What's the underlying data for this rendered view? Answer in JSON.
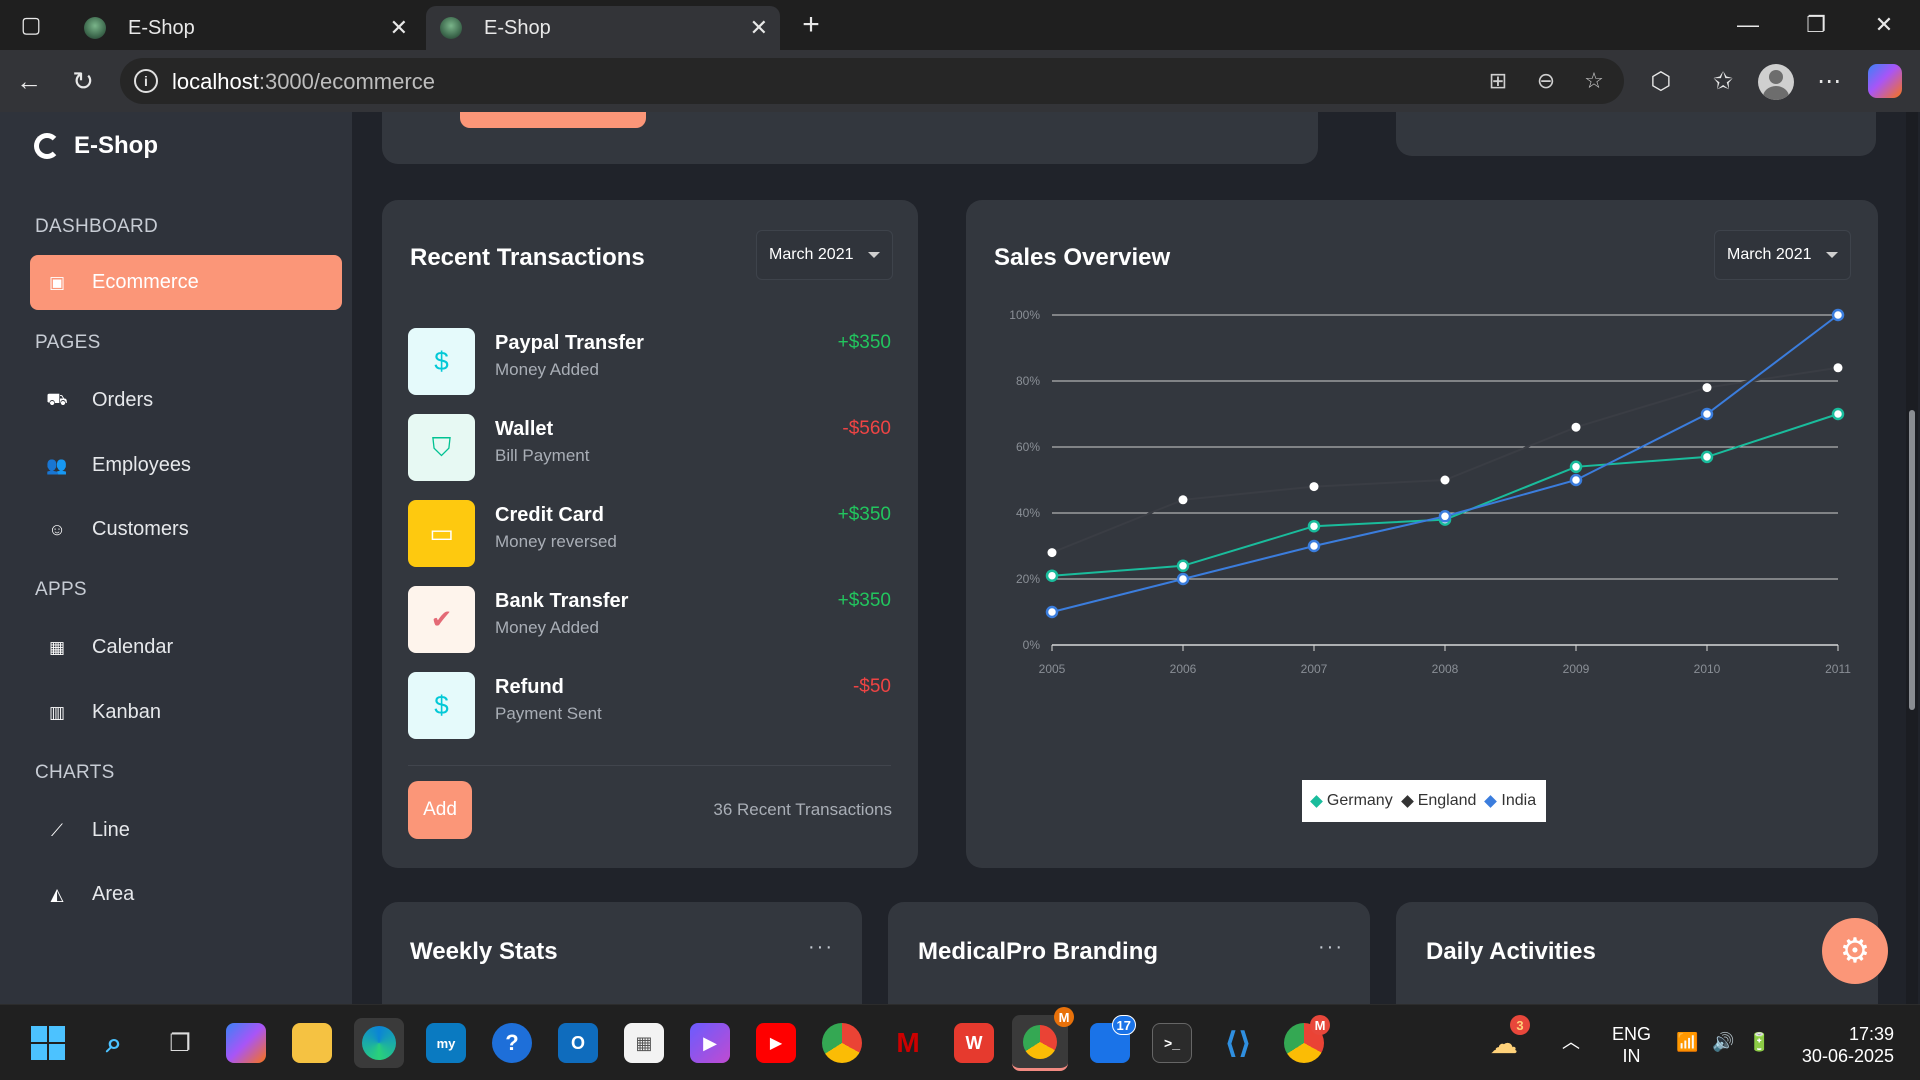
{
  "browser": {
    "tabs": [
      {
        "title": "E-Shop"
      },
      {
        "title": "E-Shop"
      }
    ],
    "new_tab": "+",
    "url_host": "localhost",
    "url_path": ":3000/ecommerce"
  },
  "sidebar": {
    "brand": "E-Shop",
    "sections": {
      "dashboard": "DASHBOARD",
      "pages": "PAGES",
      "apps": "APPS",
      "charts": "CHARTS"
    },
    "items": {
      "ecommerce": "Ecommerce",
      "orders": "Orders",
      "employees": "Employees",
      "customers": "Customers",
      "calendar": "Calendar",
      "kanban": "Kanban",
      "line": "Line",
      "area": "Area"
    }
  },
  "transactions": {
    "title": "Recent Transactions",
    "period": "March 2021",
    "items": [
      {
        "name": "Paypal Transfer",
        "desc": "Money Added",
        "amount": "+$350",
        "icon": "dollar-icon",
        "icon_color": "#03c9d7",
        "bg": "#e5fafb"
      },
      {
        "name": "Wallet",
        "desc": "Bill Payment",
        "amount": "-$560",
        "icon": "shield-icon",
        "icon_color": "#00c292",
        "bg": "#e7f9f3"
      },
      {
        "name": "Credit Card",
        "desc": "Money reversed",
        "amount": "+$350",
        "icon": "credit-card-icon",
        "icon_color": "#ffffff",
        "bg": "#fec90f"
      },
      {
        "name": "Bank Transfer",
        "desc": "Money Added",
        "amount": "+$350",
        "icon": "check-icon",
        "icon_color": "#e46a76",
        "bg": "#fef4ec"
      },
      {
        "name": "Refund",
        "desc": "Payment Sent",
        "amount": "-$50",
        "icon": "dollar-icon",
        "icon_color": "#03c9d7",
        "bg": "#e5fafb"
      }
    ],
    "add_label": "Add",
    "count_label": "36 Recent Transactions",
    "positive_color": "#22c55e",
    "negative_color": "#ef4444"
  },
  "sales": {
    "title": "Sales Overview",
    "period": "March 2021"
  },
  "chart_data": {
    "type": "line",
    "x": [
      "2005",
      "2006",
      "2007",
      "2008",
      "2009",
      "2010",
      "2011"
    ],
    "ylim": [
      0,
      100
    ],
    "yticks": [
      "0%",
      "20%",
      "40%",
      "60%",
      "80%",
      "100%"
    ],
    "grid": true,
    "legend_position": "bottom",
    "series": [
      {
        "name": "Germany",
        "values": [
          21,
          24,
          36,
          38,
          54,
          57,
          70
        ],
        "color": "#1abc9c"
      },
      {
        "name": "England",
        "values": [
          28,
          44,
          48,
          50,
          66,
          78,
          84
        ],
        "color": "#3a3d44"
      },
      {
        "name": "India",
        "values": [
          10,
          20,
          30,
          39,
          50,
          70,
          100
        ],
        "color": "#3b7ddd"
      }
    ]
  },
  "bottom_cards": {
    "weekly": "Weekly Stats",
    "medical": "MedicalPro Branding",
    "daily": "Daily Activities",
    "more": "···"
  },
  "accent": "#fb9678",
  "taskbar": {
    "lang": "ENG",
    "region": "IN",
    "time": "17:39",
    "date": "30-06-2025",
    "badges": {
      "weather": "3",
      "outlook_mail": "17",
      "chrome_a": "M",
      "chrome_b": "M"
    }
  }
}
